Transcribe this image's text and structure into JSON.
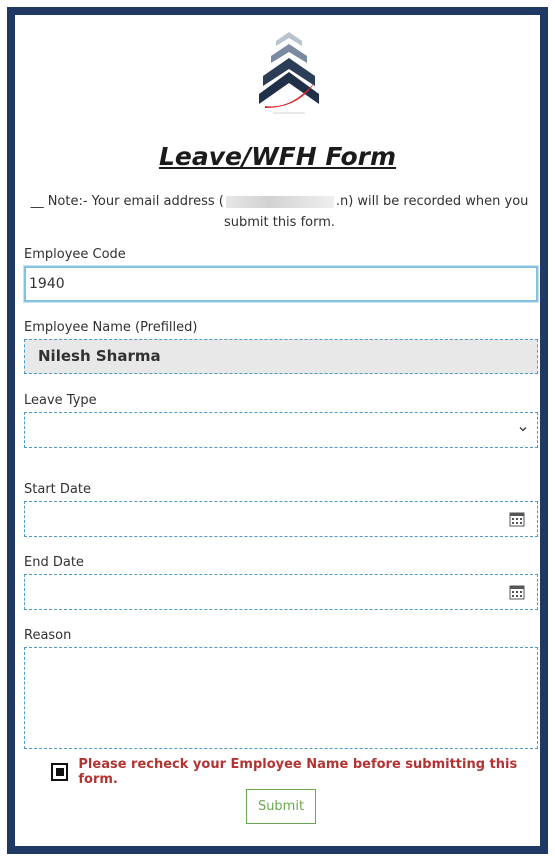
{
  "form": {
    "title": "Leave/WFH Form",
    "note_prefix": "__ Note:- Your email address (",
    "note_suffix": ".n) will be recorded when you submit this form."
  },
  "fields": {
    "employee_code": {
      "label": "Employee Code",
      "value": "1940"
    },
    "employee_name": {
      "label": "Employee Name (Prefilled)",
      "value": "Nilesh Sharma"
    },
    "leave_type": {
      "label": "Leave Type",
      "value": ""
    },
    "start_date": {
      "label": "Start Date",
      "value": ""
    },
    "end_date": {
      "label": "End Date",
      "value": ""
    },
    "reason": {
      "label": "Reason",
      "value": ""
    }
  },
  "confirm": {
    "checked": true,
    "text": "Please recheck your Employee Name before submitting this form."
  },
  "submit_label": "Submit",
  "icons": {
    "logo": "chevron-logo",
    "dropdown": "chevron-down-icon",
    "date": "calendar-icon"
  },
  "colors": {
    "frame": "#1f3864",
    "field_border": "#4f9ac7",
    "warning": "#b23432",
    "submit": "#6aa84f"
  }
}
